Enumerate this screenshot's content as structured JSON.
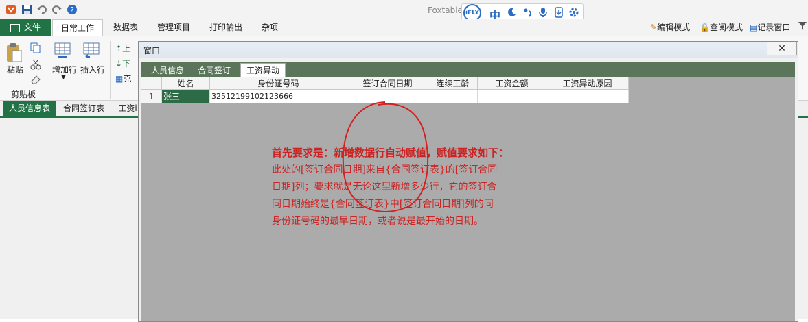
{
  "app": {
    "name": "Foxtable"
  },
  "ime": {
    "brand": "iFLY",
    "mode": "中"
  },
  "ribbon_tabs": [
    "文件",
    "日常工作",
    "数据表",
    "管理项目",
    "打印输出",
    "杂项"
  ],
  "ribbon_right": {
    "edit_mode": "编辑模式",
    "view_mode": "查阅模式",
    "log_window": "记录窗口"
  },
  "ribbon": {
    "paste": "粘贴",
    "clipboard_group": "剪贴板",
    "add_row": "增加行",
    "insert_row": "插入行",
    "up": "上",
    "down": "下",
    "clone": "克"
  },
  "doc_tabs": [
    "人员信息表",
    "合同签订表",
    "工资i"
  ],
  "window": {
    "title": "窗口",
    "close": "✕",
    "tabs": [
      "人员信息",
      "合同签订",
      "工资异动"
    ],
    "active_tab": "工资异动"
  },
  "grid": {
    "columns": [
      "姓名",
      "身份证号码",
      "签订合同日期",
      "连续工龄",
      "工资金额",
      "工资异动原因"
    ],
    "rows": [
      {
        "num": "1",
        "cells": [
          "张三",
          "32512199102123666",
          "",
          "",
          "",
          ""
        ]
      }
    ]
  },
  "note": {
    "heading": "首先要求是：新增数据行自动赋值，赋值要求如下：",
    "lines": [
      "此处的[签订合同日期]来自{合同签订表}的[签订合同",
      "日期]列；要求就是无论这里新增多少行，它的签订合",
      "同日期始终是{合同签订表}中[签订合同日期]列的同",
      "身份证号码的最早日期，或者说是最开始的日期。"
    ]
  },
  "colors": {
    "accent": "#217346",
    "tabbar": "#5a7559",
    "annotation": "#cc2222"
  }
}
